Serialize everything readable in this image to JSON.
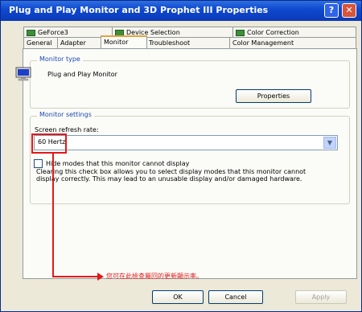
{
  "window": {
    "title": "Plug and Play Monitor and 3D Prophet III Properties",
    "help_label": "?",
    "close_label": "✕"
  },
  "tabs": {
    "row1": [
      {
        "label": "GeForce3",
        "icon": "nvidia-icon"
      },
      {
        "label": "Device Selection",
        "icon": "nvidia-icon"
      },
      {
        "label": "Color Correction",
        "icon": "nvidia-icon"
      }
    ],
    "row2": [
      {
        "label": "General"
      },
      {
        "label": "Adapter"
      },
      {
        "label": "Monitor",
        "active": true
      },
      {
        "label": "Troubleshoot"
      },
      {
        "label": "Color Management"
      }
    ]
  },
  "monitor_type": {
    "group_title": "Monitor type",
    "monitor_name": "Plug and Play Monitor",
    "properties_button": "Properties"
  },
  "monitor_settings": {
    "group_title": "Monitor settings",
    "refresh_label": "Screen refresh rate:",
    "refresh_value": "60 Hertz",
    "hide_modes_label": "Hide modes that this monitor cannot display",
    "hide_modes_checked": false,
    "description": "Clearing this check box allows you to select display modes that this monitor cannot display correctly. This may lead to an unusable display and/or damaged hardware."
  },
  "annotation": {
    "text": "您可在此檢查屬回的更新顯示率。",
    "color": "#e01a1a"
  },
  "footer": {
    "ok_label": "OK",
    "cancel_label": "Cancel",
    "apply_label": "Apply"
  }
}
